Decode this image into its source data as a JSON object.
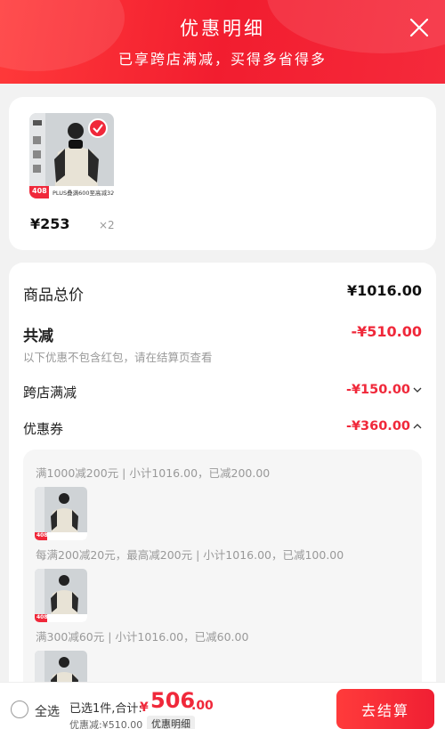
{
  "header": {
    "title": "优惠明细",
    "subtitle": "已享跨店满减，买得多省得多"
  },
  "product": {
    "price": "¥253",
    "quantity": "×2",
    "image_badge": "408",
    "image_promo": "PLUS叠满600至高减320"
  },
  "summary": {
    "total_label": "商品总价",
    "total_value": "¥1016.00",
    "reduce_label": "共减",
    "reduce_value": "-¥510.00",
    "note": "以下优惠不包含红包，请在结算页查看",
    "cross_store_label": "跨店满减",
    "cross_store_value": "-¥150.00",
    "coupon_label": "优惠券",
    "coupon_value": "-¥360.00"
  },
  "coupons": [
    {
      "rule": "满1000减200元 | 小计1016.00，已减200.00",
      "thumb_badge": "408"
    },
    {
      "rule": "每满200减20元，最高减200元 | 小计1016.00，已减100.00",
      "thumb_badge": "408"
    },
    {
      "rule": "满300减60元 | 小计1016.00，已减60.00",
      "thumb_badge": ""
    }
  ],
  "bottom_bar": {
    "select_all": "全选",
    "selected_summary": "已选1件,合计:",
    "amount_symbol": "¥",
    "amount_int": "506",
    "amount_dec": ".00",
    "reduce_text": "优惠减:¥510.00",
    "detail_button": "优惠明细",
    "checkout_button": "去结算"
  },
  "colors": {
    "accent": "#f0283a",
    "header_gradient_start": "#ff3a3a",
    "header_gradient_end": "#f52a3b"
  }
}
